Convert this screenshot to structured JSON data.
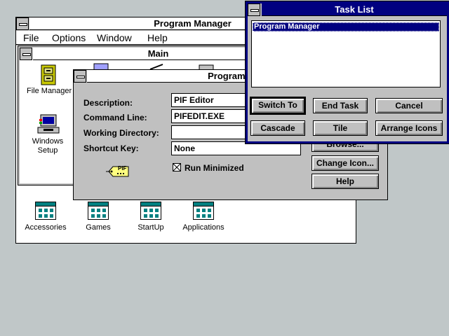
{
  "program_manager": {
    "title": "Program Manager",
    "menu": [
      "File",
      "Options",
      "Window",
      "Help"
    ],
    "groups": [
      "Accessories",
      "Games",
      "StartUp",
      "Applications"
    ]
  },
  "main_group": {
    "title": "Main",
    "icons": [
      "File Manager",
      "Windows Setup"
    ]
  },
  "program_item": {
    "title": "Program Item",
    "fields": {
      "description": {
        "label": "Description:",
        "value": "PIF Editor"
      },
      "command_line": {
        "label": "Command Line:",
        "value": "PIFEDIT.EXE"
      },
      "working_directory": {
        "label": "Working Directory:",
        "value": ""
      },
      "shortcut_key": {
        "label": "Shortcut Key:",
        "value": "None"
      }
    },
    "run_minimized": {
      "label": "Run Minimized",
      "checked": true
    },
    "buttons": {
      "browse": "Browse...",
      "change_icon": "Change Icon...",
      "help": "Help"
    },
    "pif_icon_text": "PIF"
  },
  "task_list": {
    "title": "Task List",
    "tasks": [
      "Program Manager"
    ],
    "buttons": {
      "switch_to": "Switch To",
      "end_task": "End Task",
      "cancel": "Cancel",
      "cascade": "Cascade",
      "tile": "Tile",
      "arrange_icons": "Arrange Icons"
    }
  },
  "colors": {
    "desktop": "#c0c7c8",
    "active_title": "#000080",
    "group_teal": "#008080"
  }
}
